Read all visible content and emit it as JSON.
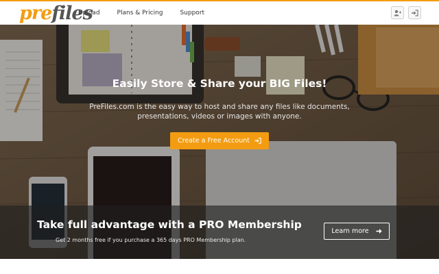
{
  "brand": {
    "logo_pre": "pre",
    "logo_files": "files",
    "accent": "#f39c12"
  },
  "nav": {
    "items": [
      {
        "label": "Upload"
      },
      {
        "label": "Plans & Pricing"
      },
      {
        "label": "Support"
      }
    ],
    "icons": [
      "add-user-icon",
      "sign-in-icon"
    ]
  },
  "hero": {
    "title": "Easily Store & Share your BIG Files!",
    "subtitle": "PreFiles.com is the easy way to host and share any files like documents, presentations, videos or images with anyone.",
    "cta_label": "Create a Free Account",
    "cta_icon": "sign-in-icon"
  },
  "pro": {
    "title": "Take full advantage with a PRO Membership",
    "subtitle": "Get 2 months free if you purchase a 365 days PRO Membership plan.",
    "button_label": "Learn more",
    "button_icon": "arrow-right-icon"
  }
}
